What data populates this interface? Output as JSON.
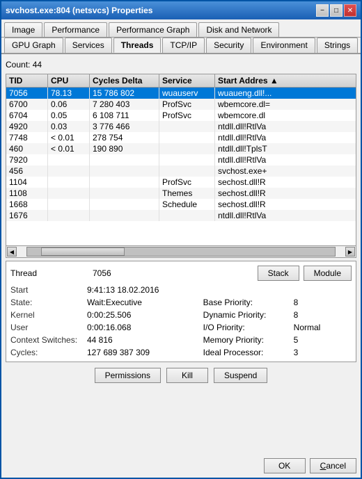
{
  "window": {
    "title": "svchost.exe:804 (netsvcs) Properties"
  },
  "titlebar": {
    "minimize": "−",
    "maximize": "□",
    "close": "✕"
  },
  "tabs_row1": [
    {
      "label": "Image",
      "active": false
    },
    {
      "label": "Performance",
      "active": false
    },
    {
      "label": "Performance Graph",
      "active": false
    },
    {
      "label": "Disk and Network",
      "active": false
    }
  ],
  "tabs_row2": [
    {
      "label": "GPU Graph",
      "active": false
    },
    {
      "label": "Services",
      "active": false
    },
    {
      "label": "Threads",
      "active": true
    },
    {
      "label": "TCP/IP",
      "active": false
    },
    {
      "label": "Security",
      "active": false
    },
    {
      "label": "Environment",
      "active": false
    },
    {
      "label": "Strings",
      "active": false
    }
  ],
  "count_label": "Count:",
  "count_value": "44",
  "table": {
    "headers": [
      "TID",
      "CPU",
      "Cycles Delta",
      "Service",
      "Start Addres"
    ],
    "rows": [
      {
        "tid": "7056",
        "cpu": "78.13",
        "cycles": "15 786 802",
        "service": "wuauserv",
        "start": "wuaueng.dll!...",
        "selected": true
      },
      {
        "tid": "6700",
        "cpu": "0.06",
        "cycles": "7 280 403",
        "service": "ProfSvc",
        "start": "wbemcore.dl="
      },
      {
        "tid": "6704",
        "cpu": "0.05",
        "cycles": "6 108 711",
        "service": "ProfSvc",
        "start": "wbemcore.dl"
      },
      {
        "tid": "4920",
        "cpu": "0.03",
        "cycles": "3 776 466",
        "service": "",
        "start": "ntdll.dll!RtlVa"
      },
      {
        "tid": "7748",
        "cpu": "< 0.01",
        "cycles": "278 754",
        "service": "",
        "start": "ntdll.dll!RtlVa"
      },
      {
        "tid": "460",
        "cpu": "< 0.01",
        "cycles": "190 890",
        "service": "",
        "start": "ntdll.dll!TplsT"
      },
      {
        "tid": "7920",
        "cpu": "",
        "cycles": "",
        "service": "",
        "start": "ntdll.dll!RtlVa"
      },
      {
        "tid": "456",
        "cpu": "",
        "cycles": "",
        "service": "",
        "start": "svchost.exe+"
      },
      {
        "tid": "1104",
        "cpu": "",
        "cycles": "",
        "service": "ProfSvc",
        "start": "sechost.dll!R"
      },
      {
        "tid": "1108",
        "cpu": "",
        "cycles": "",
        "service": "Themes",
        "start": "sechost.dll!R"
      },
      {
        "tid": "1668",
        "cpu": "",
        "cycles": "",
        "service": "Schedule",
        "start": "sechost.dll!R"
      },
      {
        "tid": "1676",
        "cpu": "",
        "cycles": "",
        "service": "",
        "start": "ntdll.dll!RtlVa"
      }
    ]
  },
  "details": {
    "thread_label": "Thread",
    "thread_value": "7056",
    "stack_btn": "Stack",
    "module_btn": "Module",
    "start_label": "Start",
    "start_value": "9:41:13   18.02.2016",
    "state_label": "State:",
    "state_value": "Wait:Executive",
    "base_priority_label": "Base Priority:",
    "base_priority_value": "8",
    "kernel_label": "Kernel",
    "kernel_value": "0:00:25.506",
    "dynamic_priority_label": "Dynamic Priority:",
    "dynamic_priority_value": "8",
    "user_label": "User",
    "user_value": "0:00:16.068",
    "io_priority_label": "I/O Priority:",
    "io_priority_value": "Normal",
    "context_switches_label": "Context Switches:",
    "context_switches_value": "44 816",
    "memory_priority_label": "Memory Priority:",
    "memory_priority_value": "5",
    "cycles_label": "Cycles:",
    "cycles_value": "127 689 387 309",
    "ideal_processor_label": "Ideal Processor:",
    "ideal_processor_value": "3"
  },
  "action_buttons": {
    "permissions": "Permissions",
    "kill": "Kill",
    "suspend": "Suspend"
  },
  "bottom_buttons": {
    "ok": "OK",
    "cancel": "Cancel"
  }
}
